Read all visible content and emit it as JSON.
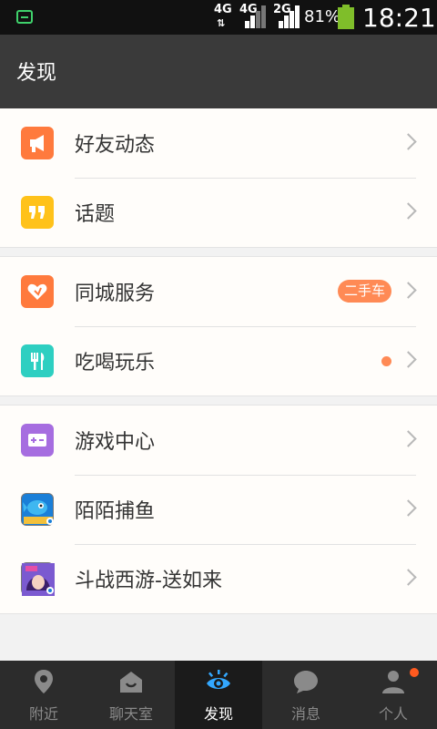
{
  "status_bar": {
    "net1": "4G",
    "net2": "4G",
    "net3": "2G",
    "battery_percent": "81%",
    "time": "18:21"
  },
  "header": {
    "title": "发现"
  },
  "groups": [
    {
      "items": [
        {
          "label": "好友动态",
          "icon": "megaphone-icon",
          "icon_color": "#ff7a3d"
        },
        {
          "label": "话题",
          "icon": "quote-icon",
          "icon_color": "#ffc21a"
        }
      ]
    },
    {
      "items": [
        {
          "label": "同城服务",
          "icon": "heart-icon",
          "icon_color": "#ff7a3d",
          "badge": "二手车"
        },
        {
          "label": "吃喝玩乐",
          "icon": "fork-knife-icon",
          "icon_color": "#2ecfc1",
          "dot": true
        }
      ]
    },
    {
      "items": [
        {
          "label": "游戏中心",
          "icon": "gamepad-icon",
          "icon_color": "#a66de0"
        },
        {
          "label": "陌陌捕鱼",
          "icon": "fishing-game-icon"
        },
        {
          "label": "斗战西游-送如来",
          "icon": "journey-game-icon"
        }
      ]
    }
  ],
  "bottom_nav": [
    {
      "label": "附近",
      "icon": "location-pin-icon"
    },
    {
      "label": "聊天室",
      "icon": "chatroom-icon"
    },
    {
      "label": "发现",
      "icon": "eye-icon",
      "active": true
    },
    {
      "label": "消息",
      "icon": "message-bubble-icon"
    },
    {
      "label": "个人",
      "icon": "person-icon",
      "notification_dot": true
    }
  ],
  "colors": {
    "accent_orange": "#ff8a55",
    "active_tab_icon": "#33a8ff",
    "notification_dot": "#ff5a1f"
  }
}
